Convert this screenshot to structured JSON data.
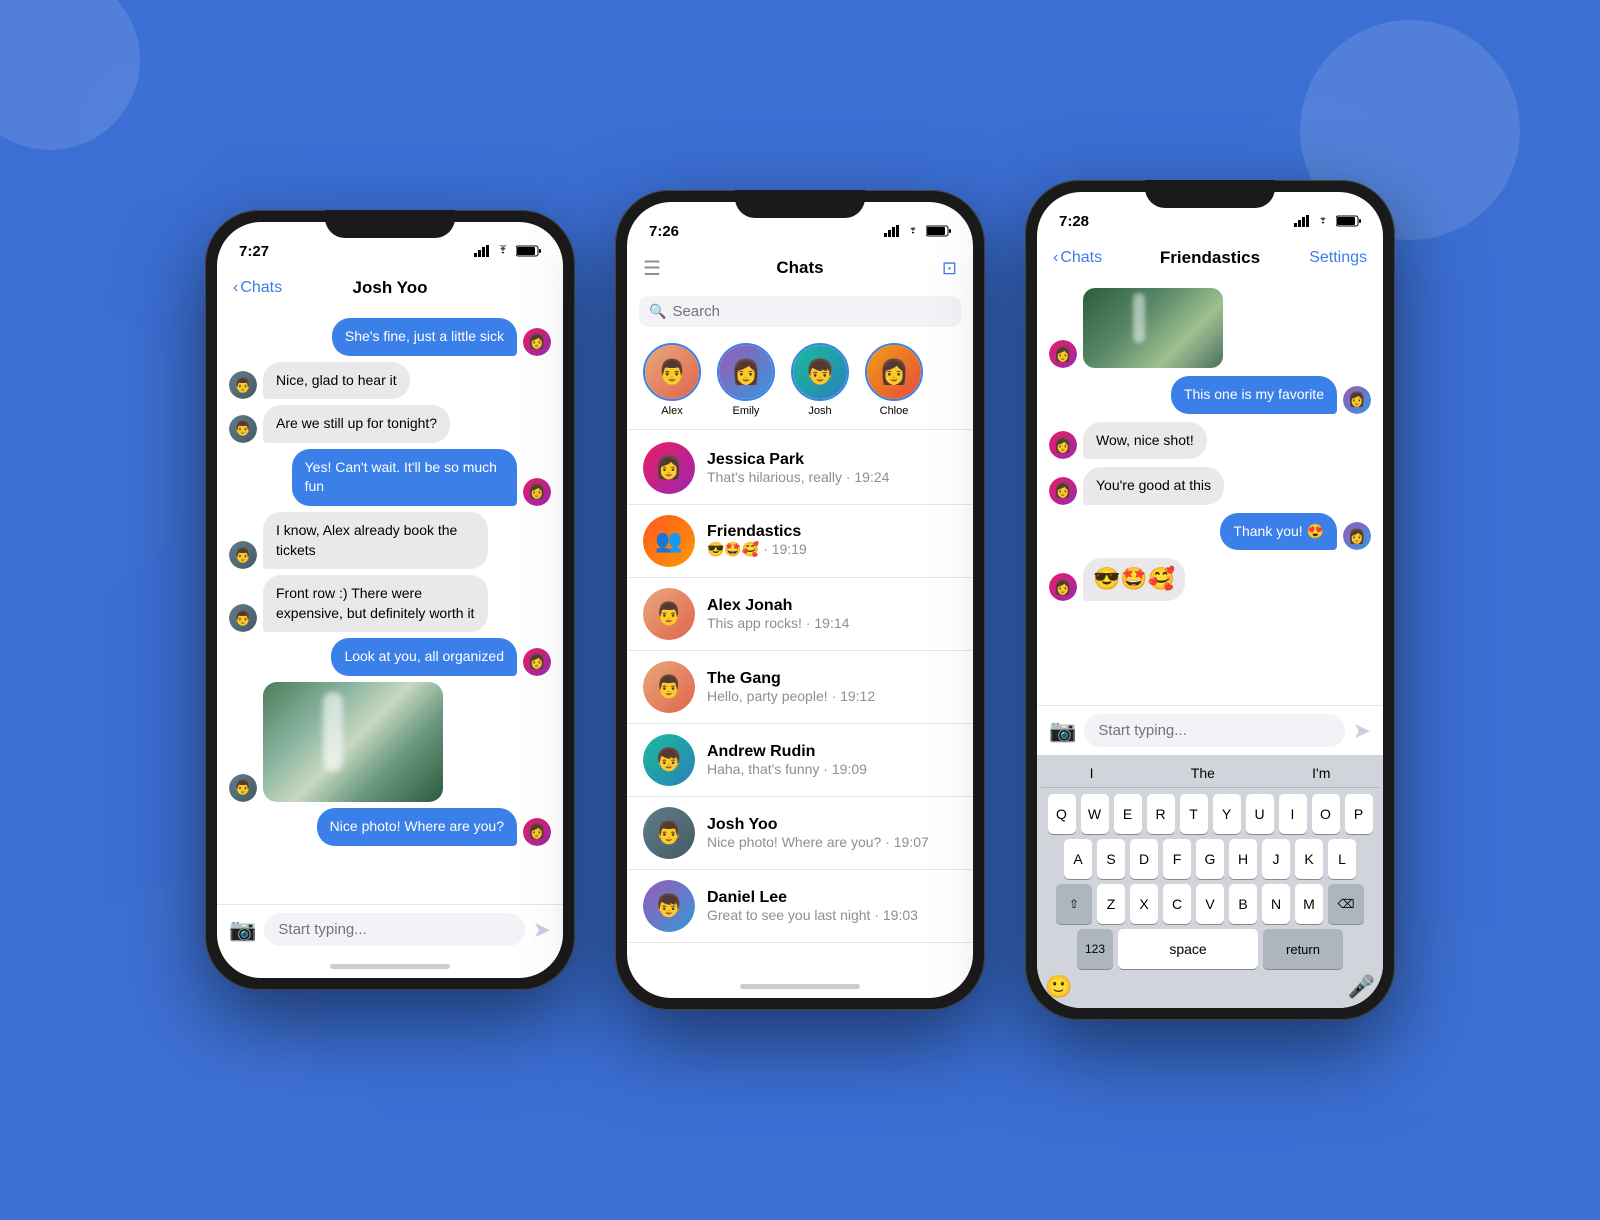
{
  "background": {
    "color": "#3B6FD4"
  },
  "phone1": {
    "time": "7:27",
    "nav": {
      "back_label": "Chats",
      "title": "Josh Yoo"
    },
    "messages": [
      {
        "type": "sent",
        "text": "She's fine, just a little sick",
        "avatar": "sent"
      },
      {
        "type": "received",
        "text": "Nice, glad to hear it"
      },
      {
        "type": "received",
        "text": "Are we still up for tonight?"
      },
      {
        "type": "sent",
        "text": "Yes! Can't wait. It'll be so much fun",
        "avatar": "sent"
      },
      {
        "type": "received",
        "text": "I know, Alex already book the tickets"
      },
      {
        "type": "received",
        "text": "Front row :) There were expensive, but definitely worth it"
      },
      {
        "type": "sent",
        "text": "Look at you, all organized",
        "avatar": "sent"
      },
      {
        "type": "received_photo"
      },
      {
        "type": "sent",
        "text": "Nice photo! Where are you?",
        "avatar": "sent"
      }
    ],
    "input": {
      "placeholder": "Start typing...",
      "camera_icon": "📷"
    }
  },
  "phone2": {
    "time": "7:26",
    "header": {
      "title": "Chats"
    },
    "search": {
      "placeholder": "Search"
    },
    "stories": [
      {
        "name": "Alex",
        "avatar": "av-1"
      },
      {
        "name": "Emily",
        "avatar": "av-2"
      },
      {
        "name": "Josh",
        "avatar": "av-3"
      },
      {
        "name": "Chloe",
        "avatar": "av-4"
      }
    ],
    "chats": [
      {
        "name": "Jessica Park",
        "preview": "That's hilarious, really · 19:24",
        "avatar": "av-5"
      },
      {
        "name": "Friendastics",
        "preview": "😎🤩🥰 · 19:19",
        "avatar": "av-6"
      },
      {
        "name": "Alex Jonah",
        "preview": "This app rocks! · 19:14",
        "avatar": "av-1"
      },
      {
        "name": "The Gang",
        "preview": "Hello, party people! · 19:12",
        "avatar": "av-7"
      },
      {
        "name": "Andrew Rudin",
        "preview": "Haha, that's funny · 19:09",
        "avatar": "av-3"
      },
      {
        "name": "Josh Yoo",
        "preview": "Nice photo! Where are you? · 19:07",
        "avatar": "av-8"
      },
      {
        "name": "Daniel Lee",
        "preview": "Great to see you last night · 19:03",
        "avatar": "av-2"
      }
    ]
  },
  "phone3": {
    "time": "7:28",
    "nav": {
      "back_label": "Chats",
      "title": "Friendastics",
      "settings_label": "Settings"
    },
    "messages": [
      {
        "type": "received_photo_group"
      },
      {
        "type": "sent",
        "text": "This one is my favorite",
        "avatar": "sent"
      },
      {
        "type": "received",
        "text": "Wow, nice shot!"
      },
      {
        "type": "received",
        "text": "You're good at this"
      },
      {
        "type": "sent",
        "text": "Thank you! 😍",
        "avatar": "sent"
      },
      {
        "type": "received_emoji",
        "text": "😎🤩🥰"
      }
    ],
    "input": {
      "placeholder": "Start typing...",
      "camera_icon": "📷"
    },
    "keyboard": {
      "suggestions": [
        "I",
        "The",
        "I'm"
      ],
      "rows": [
        [
          "Q",
          "W",
          "E",
          "R",
          "T",
          "Y",
          "U",
          "I",
          "O",
          "P"
        ],
        [
          "A",
          "S",
          "D",
          "F",
          "G",
          "H",
          "J",
          "K",
          "L"
        ],
        [
          "⇧",
          "Z",
          "X",
          "C",
          "V",
          "B",
          "N",
          "M",
          "⌫"
        ],
        [
          "123",
          "space",
          "return"
        ]
      ]
    }
  }
}
